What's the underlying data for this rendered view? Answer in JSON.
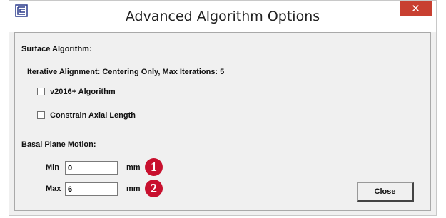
{
  "window": {
    "title": "Advanced Algorithm Options",
    "icon": "app-logo-icon",
    "close_glyph": "✕"
  },
  "surface": {
    "heading": "Surface Algorithm:",
    "description": "Iterative Alignment: Centering Only, Max Iterations: 5",
    "checkboxes": [
      {
        "label": "v2016+ Algorithm",
        "checked": false
      },
      {
        "label": "Constrain Axial Length",
        "checked": false
      }
    ]
  },
  "basal": {
    "heading": "Basal Plane Motion:",
    "min": {
      "label": "Min",
      "value": "0",
      "unit": "mm",
      "badge": "1"
    },
    "max": {
      "label": "Max",
      "value": "6",
      "unit": "mm",
      "badge": "2"
    }
  },
  "buttons": {
    "close_label": "Close"
  },
  "colors": {
    "badge": "#c8102e",
    "title_close": "#c84031",
    "client_bg": "#f0f0f0"
  }
}
